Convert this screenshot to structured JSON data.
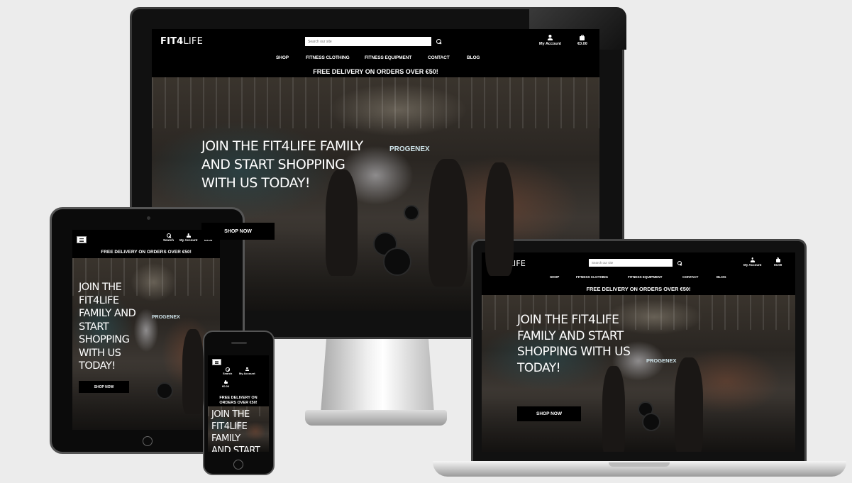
{
  "site": {
    "logo_bold": "FIT4",
    "logo_rest": "LIFE",
    "search_placeholder": "Search our site",
    "my_account": "My Account",
    "search_label": "Search",
    "cart_total": "€0.00",
    "nav": [
      "SHOP",
      "FITNESS CLOTHING",
      "FITNESS EQUIPMENT",
      "CONTACT",
      "BLOG"
    ],
    "banner": "FREE DELIVERY ON ORDERS OVER €50!",
    "hero_title": "JOIN THE FIT4LIFE FAMILY AND START SHOPPING WITH US TODAY!",
    "shop_now": "SHOP NOW",
    "gym_sign": "PROGENEX"
  },
  "mockup": {
    "devices": [
      "desktop",
      "tablet",
      "phone",
      "laptop"
    ],
    "background": "#ececec",
    "accent": "#000000"
  }
}
